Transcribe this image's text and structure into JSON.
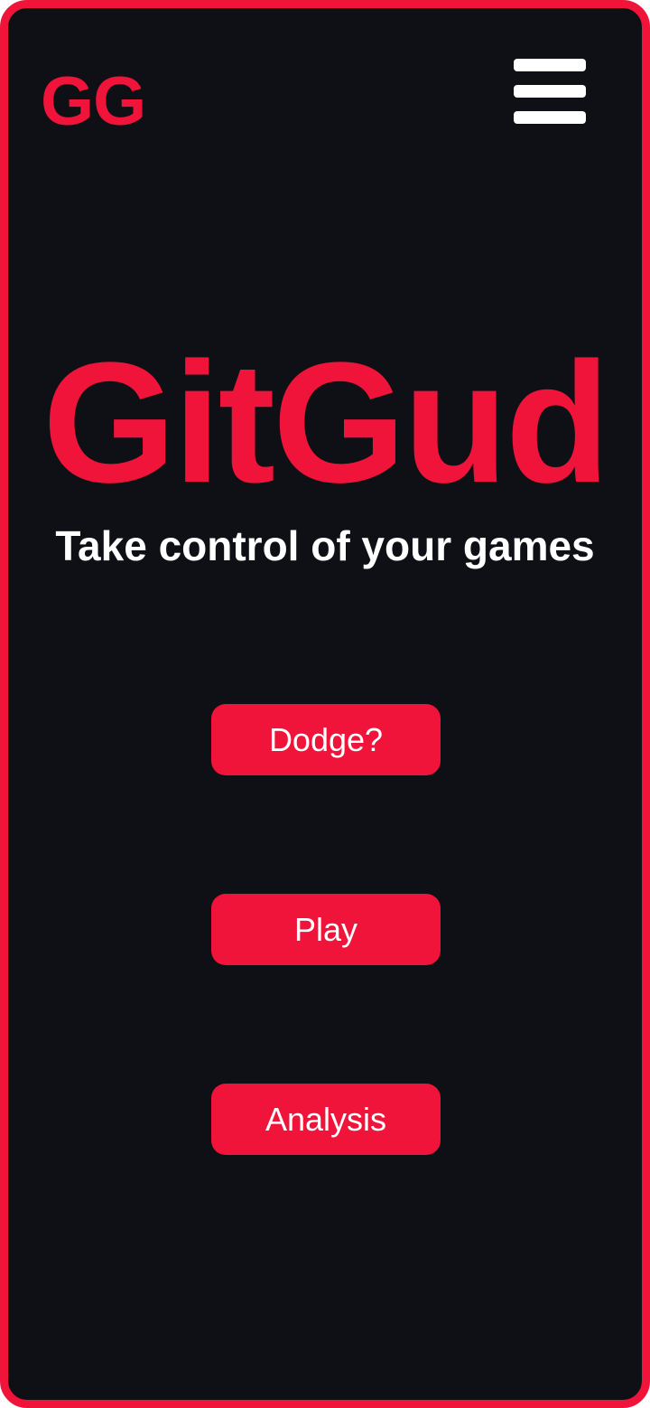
{
  "header": {
    "logo_text": "GG",
    "menu_icon": "hamburger-menu-icon"
  },
  "hero": {
    "title": "GitGud",
    "subtitle": "Take control of your games"
  },
  "actions": [
    {
      "label": "Dodge?"
    },
    {
      "label": "Play"
    },
    {
      "label": "Analysis"
    }
  ],
  "colors": {
    "accent": "#f0133a",
    "background": "#0f1015",
    "text": "#ffffff"
  }
}
